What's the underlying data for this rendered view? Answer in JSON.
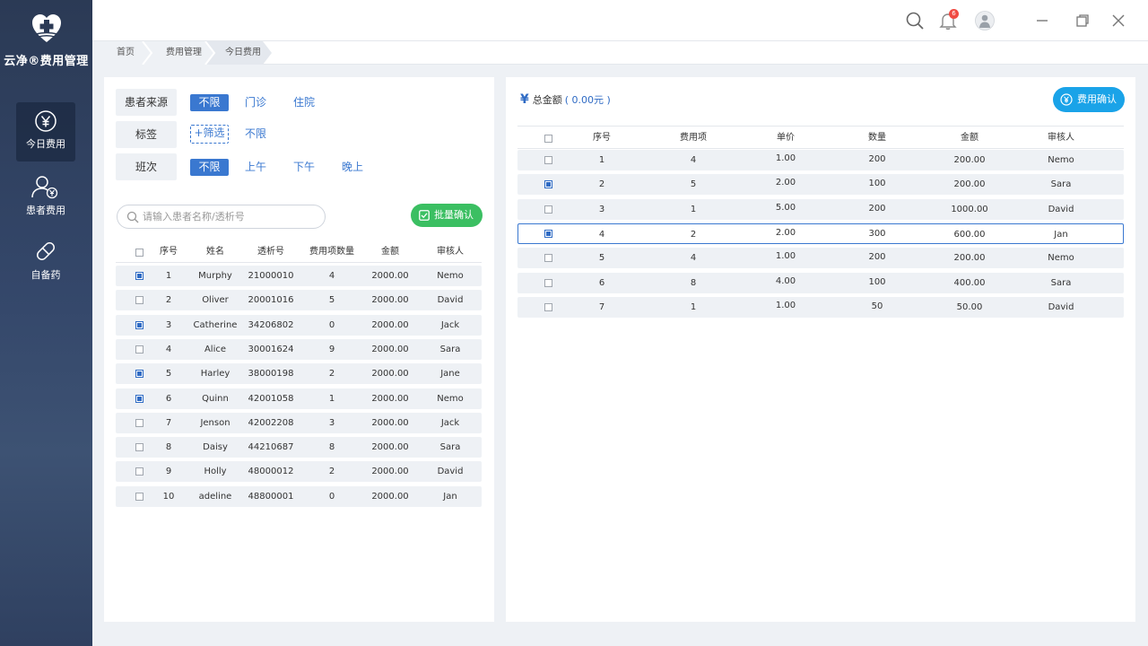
{
  "app": {
    "name": "云净®费用管理"
  },
  "sidebar": {
    "items": [
      {
        "label": "今日费用",
        "icon": "yen-circle-icon",
        "active": true
      },
      {
        "label": "患者费用",
        "icon": "patient-yen-icon",
        "active": false
      },
      {
        "label": "自备药",
        "icon": "pill-icon",
        "active": false
      }
    ]
  },
  "topbar": {
    "notification_count": "6"
  },
  "breadcrumb": [
    "首页",
    "费用管理",
    "今日费用"
  ],
  "filters": {
    "source": {
      "label": "患者来源",
      "options": [
        "不限",
        "门诊",
        "住院"
      ],
      "selected": "不限"
    },
    "tag": {
      "label": "标签",
      "add_label": "+筛选",
      "options": [
        "不限"
      ]
    },
    "shift": {
      "label": "班次",
      "options": [
        "不限",
        "上午",
        "下午",
        "晚上"
      ],
      "selected": "不限"
    }
  },
  "search": {
    "placeholder": "请输入患者名称/透析号",
    "value": ""
  },
  "batch_confirm_label": "批量确认",
  "patient_table": {
    "columns": [
      "序号",
      "姓名",
      "透析号",
      "费用项数量",
      "金额",
      "审核人"
    ],
    "rows": [
      {
        "checked": true,
        "no": "1",
        "name": "Murphy",
        "dialysis_no": "21000010",
        "items": "4",
        "amount": "2000.00",
        "reviewer": "Nemo"
      },
      {
        "checked": false,
        "no": "2",
        "name": "Oliver",
        "dialysis_no": "20001016",
        "items": "5",
        "amount": "2000.00",
        "reviewer": "David"
      },
      {
        "checked": true,
        "no": "3",
        "name": "Catherine",
        "dialysis_no": "34206802",
        "items": "0",
        "amount": "2000.00",
        "reviewer": "Jack"
      },
      {
        "checked": false,
        "no": "4",
        "name": "Alice",
        "dialysis_no": "30001624",
        "items": "9",
        "amount": "2000.00",
        "reviewer": "Sara"
      },
      {
        "checked": true,
        "no": "5",
        "name": "Harley",
        "dialysis_no": "38000198",
        "items": "2",
        "amount": "2000.00",
        "reviewer": "Jane"
      },
      {
        "checked": true,
        "no": "6",
        "name": "Quinn",
        "dialysis_no": "42001058",
        "items": "1",
        "amount": "2000.00",
        "reviewer": "Nemo"
      },
      {
        "checked": false,
        "no": "7",
        "name": "Jenson",
        "dialysis_no": "42002208",
        "items": "3",
        "amount": "2000.00",
        "reviewer": "Jack"
      },
      {
        "checked": false,
        "no": "8",
        "name": "Daisy",
        "dialysis_no": "44210687",
        "items": "8",
        "amount": "2000.00",
        "reviewer": "Sara"
      },
      {
        "checked": false,
        "no": "9",
        "name": "Holly",
        "dialysis_no": "48000012",
        "items": "2",
        "amount": "2000.00",
        "reviewer": "David"
      },
      {
        "checked": false,
        "no": "10",
        "name": "adeline",
        "dialysis_no": "48800001",
        "items": "0",
        "amount": "2000.00",
        "reviewer": "Jan"
      }
    ]
  },
  "fee_panel": {
    "total_label": "总金额",
    "total_value": "( 0.00元 )",
    "confirm_label": "费用确认",
    "currency_symbol": "¥"
  },
  "fee_table": {
    "columns": [
      "序号",
      "费用项",
      "单价",
      "数量",
      "金额",
      "审核人"
    ],
    "rows": [
      {
        "checked": false,
        "no": "1",
        "item": "4",
        "price": "1.00",
        "qty": "200",
        "amount": "200.00",
        "reviewer": "Nemo",
        "highlight": false
      },
      {
        "checked": true,
        "no": "2",
        "item": "5",
        "price": "2.00",
        "qty": "100",
        "amount": "200.00",
        "reviewer": "Sara",
        "highlight": false
      },
      {
        "checked": false,
        "no": "3",
        "item": "1",
        "price": "5.00",
        "qty": "200",
        "amount": "1000.00",
        "reviewer": "David",
        "highlight": false
      },
      {
        "checked": true,
        "no": "4",
        "item": "2",
        "price": "2.00",
        "qty": "300",
        "amount": "600.00",
        "reviewer": "Jan",
        "highlight": true
      },
      {
        "checked": false,
        "no": "5",
        "item": "4",
        "price": "1.00",
        "qty": "200",
        "amount": "200.00",
        "reviewer": "Nemo",
        "highlight": false
      },
      {
        "checked": false,
        "no": "6",
        "item": "8",
        "price": "4.00",
        "qty": "100",
        "amount": "400.00",
        "reviewer": "Sara",
        "highlight": false
      },
      {
        "checked": false,
        "no": "7",
        "item": "1",
        "price": "1.00",
        "qty": "50",
        "amount": "50.00",
        "reviewer": "David",
        "highlight": false
      }
    ]
  },
  "colors": {
    "accent": "#3a78d0",
    "green": "#3bbf62",
    "sky": "#1aa3e8",
    "sidebar": "#2b3a55"
  }
}
